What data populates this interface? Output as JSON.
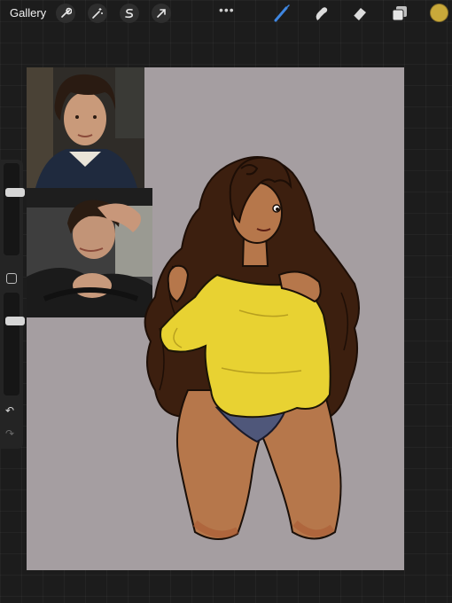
{
  "topbar": {
    "gallery_label": "Gallery",
    "left_tools": [
      "wrench-icon",
      "magic-wand-icon",
      "selection-s-icon",
      "arrow-transform-icon"
    ],
    "more_label": "•••",
    "right_tools": [
      "brush-icon",
      "smudge-icon",
      "eraser-icon",
      "layers-icon"
    ],
    "active_tool": "brush-icon",
    "current_color": "#c9a93a"
  },
  "sidebar": {
    "brush_size_level": 0.3,
    "opacity_level": 0.25,
    "undo_label": "↶",
    "redo_label": "↷"
  },
  "canvas": {
    "background_color": "#a59ea1"
  }
}
